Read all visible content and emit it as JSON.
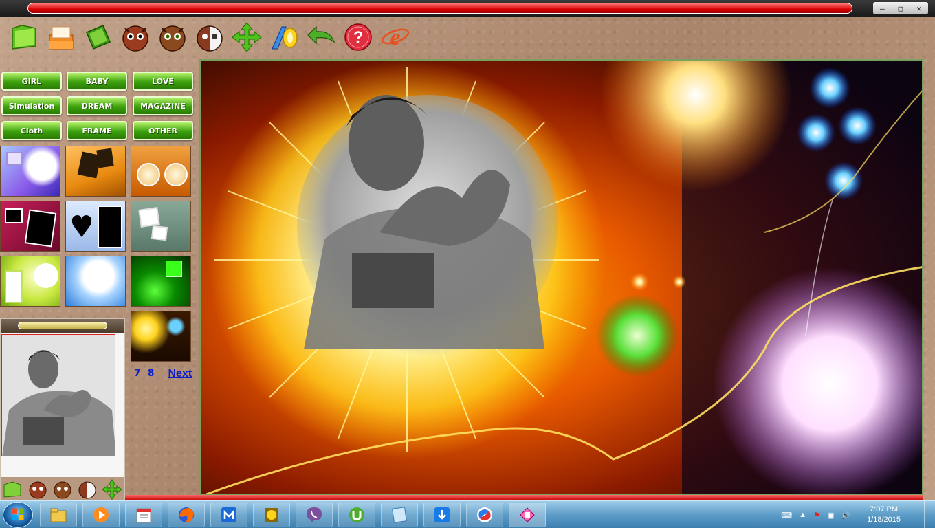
{
  "window": {
    "controls": {
      "minimize": "–",
      "restore": "□",
      "close": "✕"
    }
  },
  "toolbar": {
    "icons": [
      "folder-open-icon",
      "frame-tray-icon",
      "green-card-icon",
      "owl-red-icon",
      "owl-green-icon",
      "owl-half-icon",
      "move-arrows-icon",
      "text-tool-icon",
      "undo-arrow-icon",
      "help-icon",
      "internet-explorer-icon"
    ]
  },
  "categories": [
    {
      "label": "GIRL"
    },
    {
      "label": "BABY"
    },
    {
      "label": "LOVE"
    },
    {
      "label": "Simulation"
    },
    {
      "label": "DREAM"
    },
    {
      "label": "MAGAZINE"
    },
    {
      "label": "Cloth"
    },
    {
      "label": "FRAME"
    },
    {
      "label": "OTHER"
    }
  ],
  "pager": {
    "page7": "7",
    "page8": "8",
    "next": "Next"
  },
  "taskbar": {
    "apps": [
      "windows-explorer-icon",
      "media-player-icon",
      "calendar-icon",
      "firefox-icon",
      "maxthon-icon",
      "game-icon",
      "viber-icon",
      "utorrent-icon",
      "notepad-icon",
      "download-icon",
      "browser-icon",
      "photo-frame-app-icon"
    ],
    "clock_time": "7:07 PM",
    "clock_date": "1/18/2015"
  },
  "colors": {
    "accent_red": "#d80000",
    "button_green": "#3ba00c",
    "link_blue": "#1020c8",
    "taskbar_blue": "#5d9dc8"
  }
}
